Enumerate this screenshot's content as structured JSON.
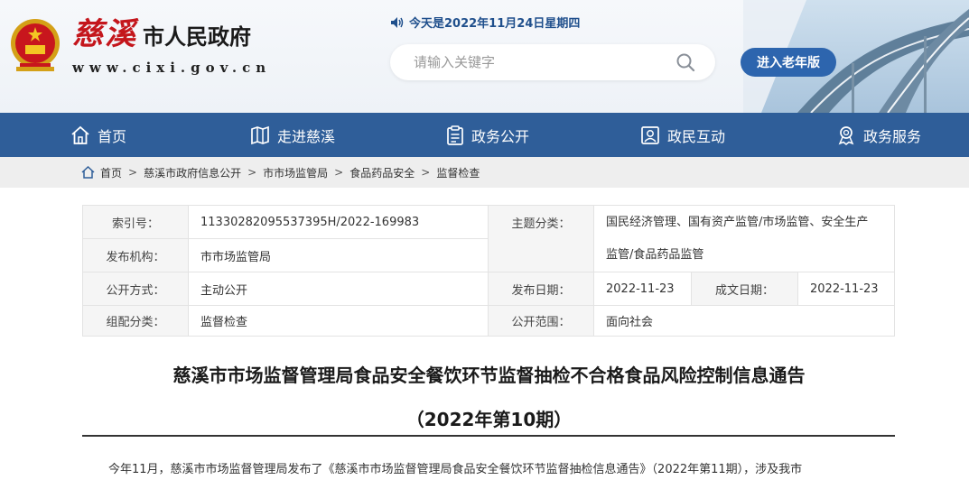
{
  "header": {
    "brand_cixi": "慈溪",
    "brand_gov": "市人民政府",
    "brand_url": "www.cixi.gov.cn",
    "date_text": "今天是2022年11月24日星期四",
    "search_placeholder": "请输入关键字",
    "elder_button": "进入老年版"
  },
  "nav": {
    "items": [
      {
        "label": "首页",
        "icon": "home-icon"
      },
      {
        "label": "走进慈溪",
        "icon": "map-icon"
      },
      {
        "label": "政务公开",
        "icon": "clipboard-icon"
      },
      {
        "label": "政民互动",
        "icon": "portrait-icon"
      },
      {
        "label": "政务服务",
        "icon": "service-badge-icon"
      }
    ]
  },
  "breadcrumb": [
    "首页",
    "慈溪市政府信息公开",
    "市市场监管局",
    "食品药品安全",
    "监督检查"
  ],
  "meta": {
    "index_label": "索引号：",
    "index_value": "11330282095537395H/2022-169983",
    "topic_label": "主题分类：",
    "topic_line1": "国民经济管理、国有资产监管/市场监管、安全生产",
    "topic_line2": "监管/食品药品监管",
    "publisher_label": "发布机构：",
    "publisher_value": "市市场监管局",
    "open_method_label": "公开方式：",
    "open_method_value": "主动公开",
    "publish_date_label": "发布日期：",
    "publish_date_value": "2022-11-23",
    "written_date_label": "成文日期：",
    "written_date_value": "2022-11-23",
    "category_label": "组配分类：",
    "category_value": "监督检查",
    "scope_label": "公开范围：",
    "scope_value": "面向社会"
  },
  "article": {
    "title_line1": "慈溪市市场监督管理局食品安全餐饮环节监督抽检不合格食品风险控制信息通告",
    "title_line2": "（2022年第10期）",
    "body_start": "今年11月，慈溪市市场监督管理局发布了《慈溪市市场监督管理局食品安全餐饮环节监督抽检信息通告》（2022年第11期），涉及我市"
  },
  "colors": {
    "nav_bg": "#2f5e99",
    "brand_red": "#c4161c",
    "accent_blue": "#2d65ae"
  }
}
